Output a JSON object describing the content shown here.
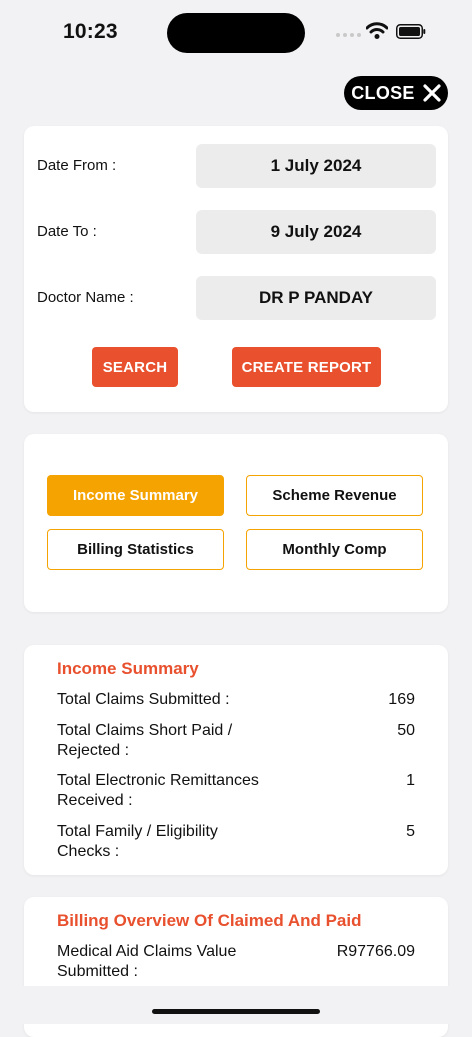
{
  "status": {
    "time": "10:23"
  },
  "close_button": {
    "label": "CLOSE"
  },
  "filters": {
    "date_from": {
      "label": "Date From :",
      "value": "1 July 2024"
    },
    "date_to": {
      "label": "Date To :",
      "value": "9 July 2024"
    },
    "doctor": {
      "label": "Doctor Name :",
      "value": "DR P PANDAY"
    },
    "search_label": "SEARCH",
    "create_report_label": "CREATE REPORT"
  },
  "tabs": [
    {
      "label": "Income Summary",
      "active": true
    },
    {
      "label": "Scheme Revenue",
      "active": false
    },
    {
      "label": "Billing Statistics",
      "active": false
    },
    {
      "label": "Monthly Comp",
      "active": false
    }
  ],
  "income_summary": {
    "title": "Income Summary",
    "rows": [
      {
        "label": "Total Claims Submitted :",
        "value": "169"
      },
      {
        "label": "Total Claims Short Paid / Rejected :",
        "value": "50"
      },
      {
        "label": "Total Electronic Remittances Received :",
        "value": "1"
      },
      {
        "label": "Total Family / Eligibility Checks :",
        "value": "5"
      }
    ]
  },
  "billing_overview": {
    "title": "Billing Overview Of Claimed And Paid",
    "rows": [
      {
        "label": "Medical Aid Claims Value Submitted :",
        "value": "R97766.09"
      }
    ]
  },
  "colors": {
    "accent": "#e8502e",
    "tab_active": "#f5a300"
  },
  "icons": {
    "close": "close-icon",
    "wifi": "wifi-icon",
    "battery": "battery-icon",
    "signal": "signal-icon"
  }
}
